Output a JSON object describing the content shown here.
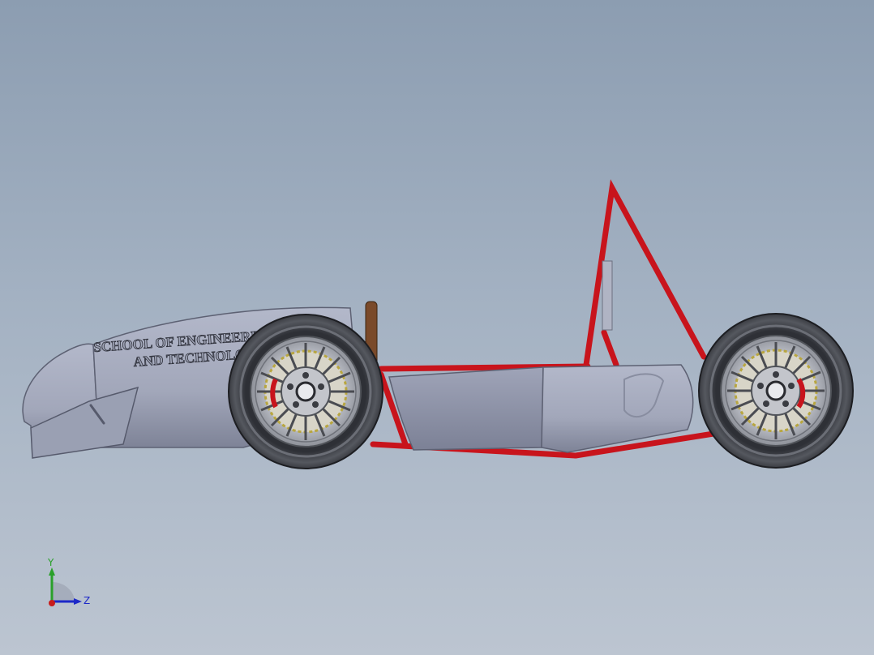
{
  "viewport": {
    "background_top": "#8c9db1",
    "background_bottom": "#bcc5d1"
  },
  "model": {
    "body_text_line1": "SCHOOL OF ENGINEERING",
    "body_text_line2": "AND TECHNOLOGY",
    "body_color": "#a4a9bd",
    "frame_color": "#c8141c",
    "tire_color": "#3c3e44",
    "seat_color": "#7a4a2a"
  },
  "triad": {
    "y_label": "Y",
    "z_label": "Z",
    "y_color": "#2aa02a",
    "z_color": "#1c28c8",
    "x_color": "#c81c1c"
  }
}
